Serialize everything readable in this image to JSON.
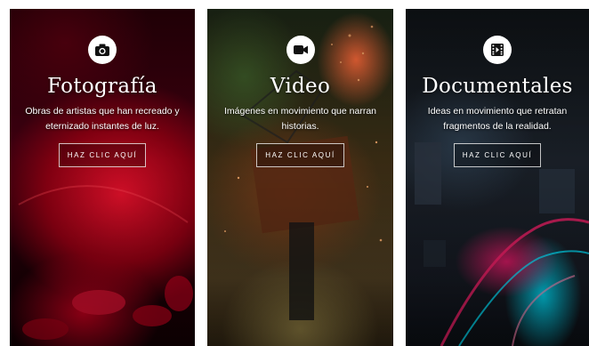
{
  "cards": [
    {
      "title": "Fotografía",
      "description": "Obras de artistas que han recreado y eternizado instantes de luz.",
      "button_label": "HAZ CLIC AQUÍ",
      "icon": "camera-icon"
    },
    {
      "title": "Video",
      "description": "Imágenes en movimiento que narran historias.",
      "button_label": "HAZ CLIC AQUÍ",
      "icon": "video-camera-icon"
    },
    {
      "title": "Documentales",
      "description": "Ideas en movimiento que retratan fragmentos de la realidad.",
      "button_label": "HAZ CLIC AQUÍ",
      "icon": "film-icon"
    }
  ],
  "colors": {
    "text": "#ffffff",
    "icon_circle": "#ffffff",
    "icon_glyph": "#111111"
  }
}
